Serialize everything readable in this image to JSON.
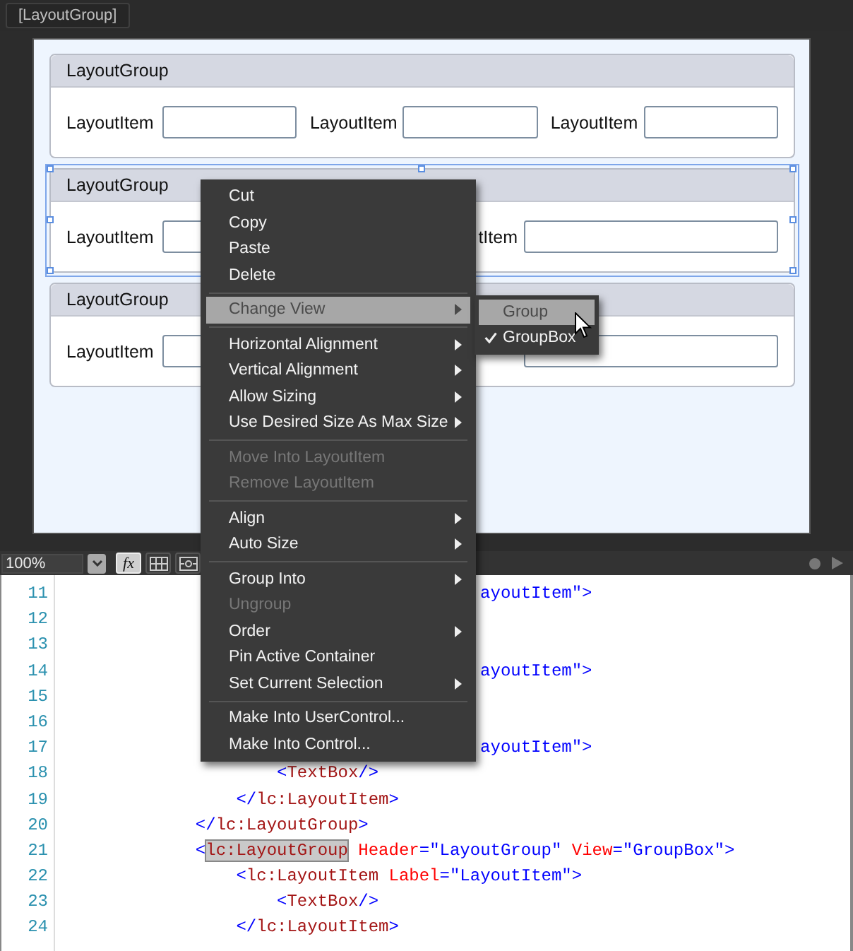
{
  "tab": {
    "label": "[LayoutGroup]"
  },
  "groups": [
    {
      "header": "LayoutGroup",
      "selected": false,
      "items": [
        {
          "kind": "labeled",
          "label": "LayoutItem"
        },
        {
          "kind": "labeled",
          "label": "LayoutItem"
        },
        {
          "kind": "labeled",
          "label": "LayoutItem"
        }
      ]
    },
    {
      "header": "LayoutGroup",
      "selected": true,
      "items": [
        {
          "kind": "labeled",
          "label": "LayoutItem"
        },
        {
          "kind": "labeled",
          "label": "tItem"
        }
      ]
    },
    {
      "header": "LayoutGroup",
      "selected": false,
      "items": [
        {
          "kind": "labeled",
          "label": "LayoutItem"
        },
        {
          "kind": "field_only"
        }
      ]
    }
  ],
  "toolbar": {
    "zoom": "100%",
    "buttons": [
      {
        "kind": "formula",
        "label": "fx",
        "pressed": true
      },
      {
        "kind": "grid",
        "pressed": false
      },
      {
        "kind": "snap",
        "pressed": false
      }
    ]
  },
  "editor": {
    "lines": [
      {
        "number": "11",
        "tokens": [
          {
            "text": "                                        ayoutItem\">",
            "kind": "value"
          }
        ]
      },
      {
        "number": "12"
      },
      {
        "number": "13"
      },
      {
        "number": "14",
        "tokens": [
          {
            "text": "                                        ayoutItem\">",
            "kind": "value"
          }
        ]
      },
      {
        "number": "15"
      },
      {
        "number": "16"
      },
      {
        "number": "17",
        "tokens": [
          {
            "text": "                                        ayoutItem\">",
            "kind": "value"
          }
        ]
      },
      {
        "number": "18",
        "tokens": [
          {
            "text": "                    <",
            "kind": "punct"
          },
          {
            "text": "TextBox",
            "kind": "tag"
          },
          {
            "text": "/>",
            "kind": "punct"
          }
        ]
      },
      {
        "number": "19",
        "tokens": [
          {
            "text": "                </",
            "kind": "punct"
          },
          {
            "text": "lc:LayoutItem",
            "kind": "tag"
          },
          {
            "text": ">",
            "kind": "punct"
          }
        ]
      },
      {
        "number": "20",
        "tokens": [
          {
            "text": "            </",
            "kind": "punct"
          },
          {
            "text": "lc:LayoutGroup",
            "kind": "tag"
          },
          {
            "text": ">",
            "kind": "punct"
          }
        ]
      },
      {
        "number": "21",
        "tokens": [
          {
            "text": "            <",
            "kind": "punct"
          },
          {
            "text": "lc:LayoutGroup",
            "kind": "highlighted"
          },
          {
            "text": " Header",
            "kind": "attr"
          },
          {
            "text": "=\"LayoutGroup\"",
            "kind": "value"
          },
          {
            "text": " View",
            "kind": "attr"
          },
          {
            "text": "=\"GroupBox\"",
            "kind": "value"
          },
          {
            "text": ">",
            "kind": "punct"
          }
        ]
      },
      {
        "number": "22",
        "tokens": [
          {
            "text": "                <",
            "kind": "punct"
          },
          {
            "text": "lc:LayoutItem",
            "kind": "tag"
          },
          {
            "text": " Label",
            "kind": "attr"
          },
          {
            "text": "=\"LayoutItem\"",
            "kind": "value"
          },
          {
            "text": ">",
            "kind": "punct"
          }
        ]
      },
      {
        "number": "23",
        "tokens": [
          {
            "text": "                    <",
            "kind": "punct"
          },
          {
            "text": "TextBox",
            "kind": "tag"
          },
          {
            "text": "/>",
            "kind": "punct"
          }
        ]
      },
      {
        "number": "24",
        "tokens": [
          {
            "text": "                </",
            "kind": "punct"
          },
          {
            "text": "lc:LayoutItem",
            "kind": "tag"
          },
          {
            "text": ">",
            "kind": "punct"
          }
        ]
      }
    ]
  },
  "context_menu": {
    "items": [
      {
        "kind": "item",
        "label": "Cut",
        "disabled": false,
        "submenu": false,
        "selected": false
      },
      {
        "kind": "item",
        "label": "Copy",
        "disabled": false,
        "submenu": false,
        "selected": false
      },
      {
        "kind": "item",
        "label": "Paste",
        "disabled": false,
        "submenu": false,
        "selected": false
      },
      {
        "kind": "item",
        "label": "Delete",
        "disabled": false,
        "submenu": false,
        "selected": false
      },
      {
        "kind": "separator"
      },
      {
        "kind": "item",
        "label": "Change View",
        "disabled": false,
        "submenu": true,
        "selected": true
      },
      {
        "kind": "separator"
      },
      {
        "kind": "item",
        "label": "Horizontal Alignment",
        "disabled": false,
        "submenu": true,
        "selected": false
      },
      {
        "kind": "item",
        "label": "Vertical Alignment",
        "disabled": false,
        "submenu": true,
        "selected": false
      },
      {
        "kind": "item",
        "label": "Allow Sizing",
        "disabled": false,
        "submenu": true,
        "selected": false
      },
      {
        "kind": "item",
        "label": "Use Desired Size As Max Size",
        "disabled": false,
        "submenu": true,
        "selected": false
      },
      {
        "kind": "separator"
      },
      {
        "kind": "item",
        "label": "Move Into LayoutItem",
        "disabled": true,
        "submenu": false,
        "selected": false
      },
      {
        "kind": "item",
        "label": "Remove LayoutItem",
        "disabled": true,
        "submenu": false,
        "selected": false
      },
      {
        "kind": "separator"
      },
      {
        "kind": "item",
        "label": "Align",
        "disabled": false,
        "submenu": true,
        "selected": false
      },
      {
        "kind": "item",
        "label": "Auto Size",
        "disabled": false,
        "submenu": true,
        "selected": false
      },
      {
        "kind": "separator"
      },
      {
        "kind": "item",
        "label": "Group Into",
        "disabled": false,
        "submenu": true,
        "selected": false
      },
      {
        "kind": "item",
        "label": "Ungroup",
        "disabled": true,
        "submenu": false,
        "selected": false
      },
      {
        "kind": "item",
        "label": "Order",
        "disabled": false,
        "submenu": true,
        "selected": false
      },
      {
        "kind": "item",
        "label": "Pin Active Container",
        "disabled": false,
        "submenu": false,
        "selected": false
      },
      {
        "kind": "item",
        "label": "Set Current Selection",
        "disabled": false,
        "submenu": true,
        "selected": false
      },
      {
        "kind": "separator"
      },
      {
        "kind": "item",
        "label": "Make Into UserControl...",
        "disabled": false,
        "submenu": false,
        "selected": false
      },
      {
        "kind": "item",
        "label": "Make Into Control...",
        "disabled": false,
        "submenu": false,
        "selected": false
      }
    ]
  },
  "submenu": {
    "items": [
      {
        "label": "Group",
        "checked": false,
        "selected": true
      },
      {
        "label": "GroupBox",
        "checked": true,
        "selected": false
      }
    ]
  }
}
